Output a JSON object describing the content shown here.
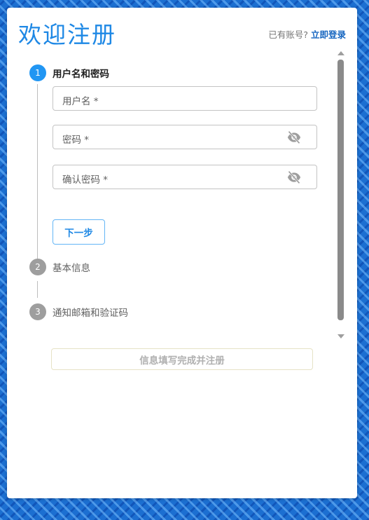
{
  "header": {
    "title": "欢迎注册",
    "has_account_text": "已有账号?",
    "login_link": "立即登录"
  },
  "steps": [
    {
      "number": "1",
      "label": "用户名和密码",
      "state": "active"
    },
    {
      "number": "2",
      "label": "基本信息",
      "state": "inactive"
    },
    {
      "number": "3",
      "label": "通知邮箱和验证码",
      "state": "inactive"
    }
  ],
  "form": {
    "username_label": "用户名 *",
    "password_label": "密码 *",
    "confirm_password_label": "确认密码 *",
    "password_toggle_icon": "eye-off-icon",
    "next_button": "下一步"
  },
  "submit_button": "信息填写完成并注册",
  "colors": {
    "accent": "#1e88e5",
    "step_active": "#2196f3",
    "step_inactive": "#9e9e9e",
    "background": "#1c6fd1"
  }
}
